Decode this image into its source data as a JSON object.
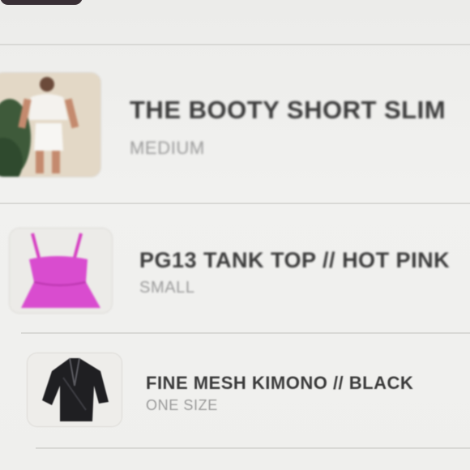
{
  "cart": {
    "items": [
      {
        "title": "THE BOOTY SHORT SLIM",
        "variant": "MEDIUM",
        "image": "white-outfit-photo"
      },
      {
        "title": "PG13 TANK TOP // HOT PINK",
        "variant": "SMALL",
        "image": "pink-tank-top-photo"
      },
      {
        "title": "FINE MESH KIMONO // BLACK",
        "variant": "ONE SIZE",
        "image": "black-kimono-photo"
      }
    ]
  }
}
